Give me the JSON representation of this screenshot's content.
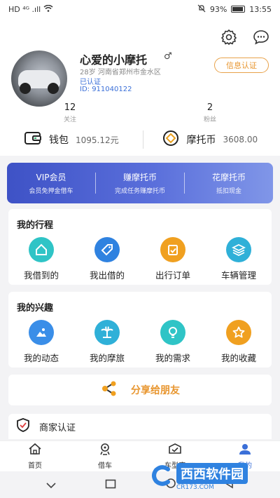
{
  "status": {
    "left": "HD ⁴ᴳ .ıll",
    "battery": "93%",
    "time": "13:55"
  },
  "profile": {
    "name": "心爱的小摩托",
    "gender_symbol": "♂",
    "info": "28岁  河南省郑州市金水区",
    "verified": "已认证",
    "uid": "ID: 911040122",
    "cert_button": "信息认证"
  },
  "stats": [
    {
      "num": "12",
      "label": "关注"
    },
    {
      "num": "2",
      "label": "粉丝"
    }
  ],
  "wallet": {
    "wallet_label": "钱包",
    "wallet_value": "1095.12元",
    "coin_label": "摩托币",
    "coin_value": "3608.00"
  },
  "vip": [
    {
      "title": "VIP会员",
      "sub": "会员免押金借车"
    },
    {
      "title": "赚摩托币",
      "sub": "完成任务赚摩托币"
    },
    {
      "title": "花摩托币",
      "sub": "抵扣现金"
    }
  ],
  "trips": {
    "title": "我的行程",
    "items": [
      {
        "label": "我借到的",
        "icon": "home-icon",
        "color": "#2fc4c6"
      },
      {
        "label": "我出借的",
        "icon": "tag-icon",
        "color": "#2f82e0"
      },
      {
        "label": "出行订单",
        "icon": "order-icon",
        "color": "#f0a020"
      },
      {
        "label": "车辆管理",
        "icon": "layers-icon",
        "color": "#2fb0d8"
      }
    ]
  },
  "interests": {
    "title": "我的兴趣",
    "items": [
      {
        "label": "我的动态",
        "icon": "image-icon",
        "color": "#3a8ee8"
      },
      {
        "label": "我的摩旅",
        "icon": "palm-icon",
        "color": "#2fb0d8"
      },
      {
        "label": "我的需求",
        "icon": "bulb-icon",
        "color": "#2fc4c6"
      },
      {
        "label": "我的收藏",
        "icon": "star-icon",
        "color": "#f0a020"
      }
    ]
  },
  "share": {
    "label": "分享给朋友"
  },
  "merchant": {
    "label": "商家认证"
  },
  "tabs": [
    {
      "label": "首页",
      "icon": "home-tab-icon"
    },
    {
      "label": "借车",
      "icon": "bike-tab-icon"
    },
    {
      "label": "车型库",
      "icon": "garage-tab-icon"
    },
    {
      "label": "我的",
      "icon": "user-tab-icon"
    }
  ],
  "watermark": {
    "main": "西西软件园",
    "sub": "CR173.COM"
  }
}
